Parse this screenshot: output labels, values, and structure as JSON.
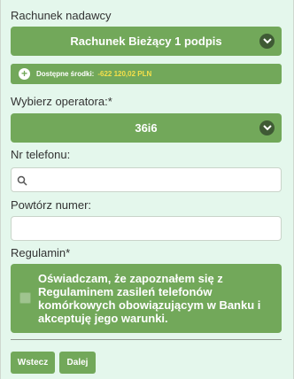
{
  "sender": {
    "label": "Rachunek nadawcy",
    "selected": "Rachunek Bieżący 1 podpis"
  },
  "funds": {
    "label": "Dostępne środki:",
    "value": "-622 120,02 PLN"
  },
  "operator": {
    "label": "Wybierz operatora:*",
    "selected": "36i6"
  },
  "phone": {
    "label": "Nr telefonu:",
    "value": "",
    "placeholder": ""
  },
  "repeat": {
    "label": "Powtórz numer:",
    "value": "",
    "placeholder": ""
  },
  "terms": {
    "label": "Regulamin*",
    "text": "Oświadczam, że zapoznałem się z Regulaminem zasileń telefonów komórkowych obowiązującym w Banku i akceptuję jego warunki.",
    "checked": false
  },
  "buttons": {
    "back": "Wstecz",
    "next": "Dalej"
  },
  "colors": {
    "accent": "#72a85a",
    "background": "#e4f7ec",
    "funds_value": "#f5e04a"
  }
}
